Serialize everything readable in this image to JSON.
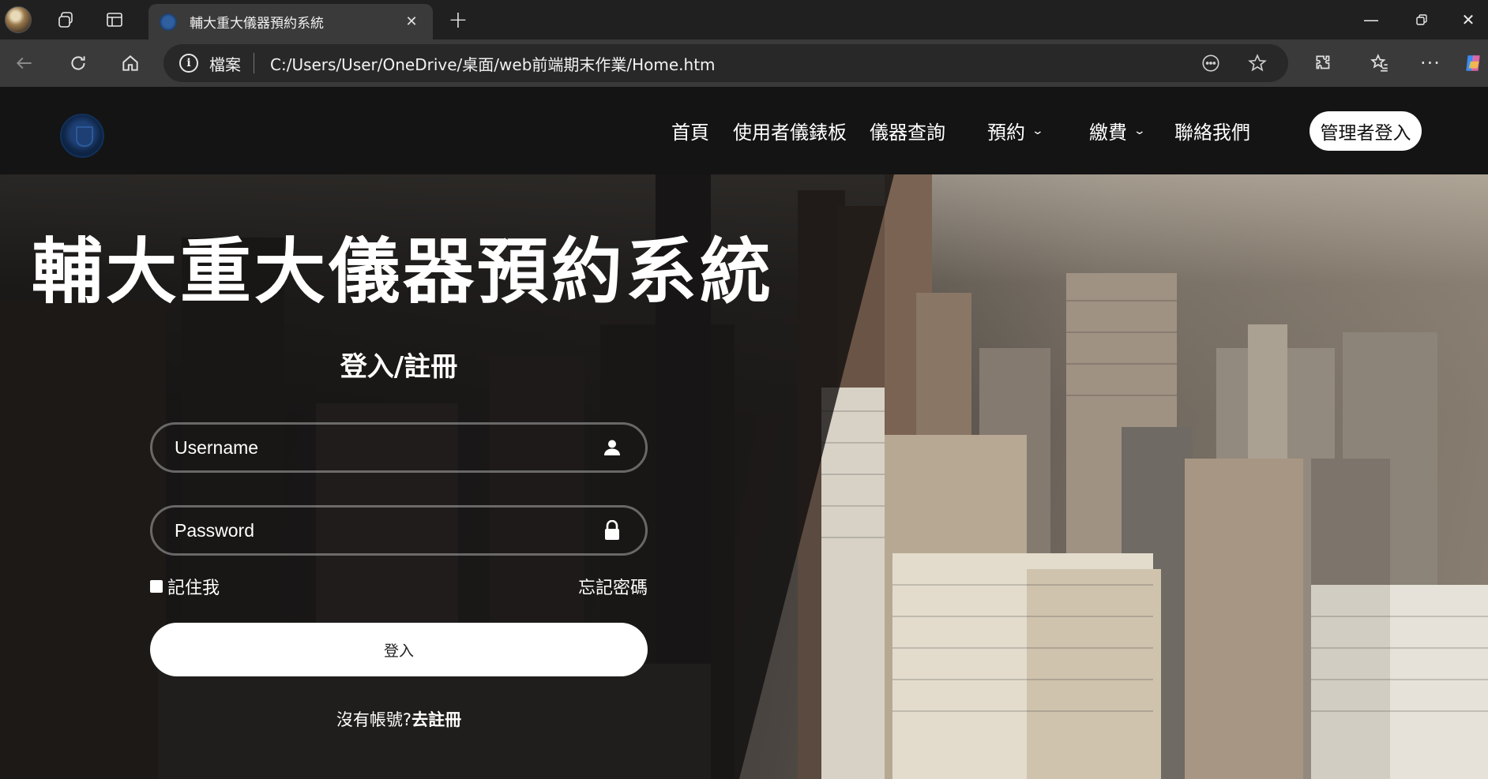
{
  "browser": {
    "tab_title": "輔大重大儀器預約系統",
    "address": {
      "scheme_label": "檔案",
      "url": "C:/Users/User/OneDrive/桌面/web前端期末作業/Home.htm"
    }
  },
  "site": {
    "nav": {
      "home": "首頁",
      "dashboard": "使用者儀錶板",
      "instrument_query": "儀器查詢",
      "booking": "預約",
      "payment": "繳費",
      "contact": "聯絡我們",
      "admin_login": "管理者登入"
    },
    "hero_title": "輔大重大儀器預約系統",
    "login": {
      "heading": "登入/註冊",
      "username_placeholder": "Username",
      "password_placeholder": "Password",
      "remember_label": "記住我",
      "forgot_label": "忘記密碼",
      "submit_label": "登入",
      "register_prefix": "沒有帳號?",
      "register_link": "去註冊"
    }
  },
  "icons": {
    "username_field": "user-icon",
    "password_field": "lock-icon"
  }
}
